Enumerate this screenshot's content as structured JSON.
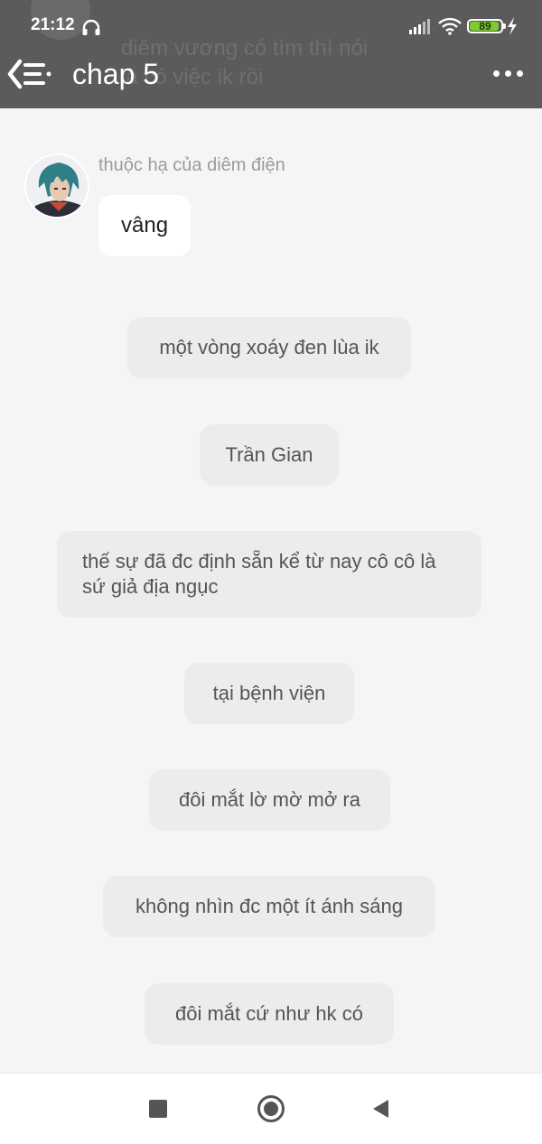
{
  "status_bar": {
    "time": "21:12",
    "battery": "89",
    "battery_level": 0.89,
    "icons": [
      "headphone-icon",
      "signal-icon",
      "wifi-icon",
      "battery-icon",
      "charging-bolt-icon"
    ]
  },
  "background_overlay_text": "diêm vương có tìm thì nói\nlà có việc ik rồi",
  "nav": {
    "title": "chap 5",
    "back_icon": "back-menu-icon",
    "more_icon": "more-dots-icon"
  },
  "message": {
    "sender": "thuộc hạ của diêm điện",
    "text": "vâng"
  },
  "narration": [
    "một vòng xoáy đen lùa ik",
    "Trần Gian",
    "thế sự đã đc định sẵn kể từ nay cô cô là sứ giả địa ngục",
    "tại bệnh viện",
    "đôi mắt lờ mờ mở ra",
    "không nhìn đc một ít ánh sáng",
    "đôi mắt cứ như hk có"
  ],
  "colors": {
    "header": "#5b5b5b",
    "background": "#f5f5f5",
    "bubble": "#ececec",
    "battery": "#7ecb2f"
  }
}
